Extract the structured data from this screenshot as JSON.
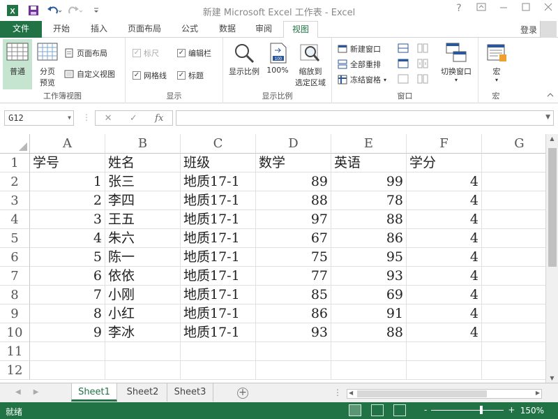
{
  "window": {
    "title": "新建 Microsoft Excel 工作表 - Excel",
    "help": "?"
  },
  "tabs": [
    {
      "label": "文件"
    },
    {
      "label": "开始"
    },
    {
      "label": "插入"
    },
    {
      "label": "页面布局"
    },
    {
      "label": "公式"
    },
    {
      "label": "数据"
    },
    {
      "label": "审阅"
    },
    {
      "label": "视图"
    }
  ],
  "login": "登录",
  "ribbon": {
    "workbook_views": {
      "label": "工作簿视图",
      "normal": "普通",
      "pagebreak_line1": "分页",
      "pagebreak_line2": "预览",
      "page_layout": "页面布局",
      "custom_views": "自定义视图"
    },
    "show": {
      "label": "显示",
      "ruler": "标尺",
      "formula_bar": "编辑栏",
      "gridlines": "网格线",
      "headings": "标题"
    },
    "zoom": {
      "label": "显示比例",
      "zoom": "显示比例",
      "zoom100": "100%",
      "zoom_sel_line1": "缩放到",
      "zoom_sel_line2": "选定区域"
    },
    "window": {
      "label": "窗口",
      "new_window": "新建窗口",
      "arrange_all": "全部重排",
      "freeze_panes": "冻结窗格",
      "switch_windows": "切换窗口"
    },
    "macros": {
      "label": "宏",
      "macros": "宏"
    }
  },
  "formula_bar": {
    "name_box": "G12",
    "fx": "fx",
    "value": ""
  },
  "columns": [
    "A",
    "B",
    "C",
    "D",
    "E",
    "F",
    "G"
  ],
  "rows": [
    {
      "n": "1",
      "a": "学号",
      "b": "姓名",
      "c": "班级",
      "d": "数学",
      "e": "英语",
      "f": "学分"
    },
    {
      "n": "2",
      "a": "1",
      "b": "张三",
      "c": "地质17-1",
      "d": "89",
      "e": "99",
      "f": "4"
    },
    {
      "n": "3",
      "a": "2",
      "b": "李四",
      "c": "地质17-1",
      "d": "88",
      "e": "78",
      "f": "4"
    },
    {
      "n": "4",
      "a": "3",
      "b": "王五",
      "c": "地质17-1",
      "d": "97",
      "e": "88",
      "f": "4"
    },
    {
      "n": "5",
      "a": "4",
      "b": "朱六",
      "c": "地质17-1",
      "d": "67",
      "e": "86",
      "f": "4"
    },
    {
      "n": "6",
      "a": "5",
      "b": "陈一",
      "c": "地质17-1",
      "d": "75",
      "e": "95",
      "f": "4"
    },
    {
      "n": "7",
      "a": "6",
      "b": "依依",
      "c": "地质17-1",
      "d": "77",
      "e": "93",
      "f": "4"
    },
    {
      "n": "8",
      "a": "7",
      "b": "小刚",
      "c": "地质17-1",
      "d": "85",
      "e": "69",
      "f": "4"
    },
    {
      "n": "9",
      "a": "8",
      "b": "小红",
      "c": "地质17-1",
      "d": "86",
      "e": "91",
      "f": "4"
    },
    {
      "n": "10",
      "a": "9",
      "b": "李冰",
      "c": "地质17-1",
      "d": "93",
      "e": "88",
      "f": "4"
    },
    {
      "n": "11",
      "a": "",
      "b": "",
      "c": "",
      "d": "",
      "e": "",
      "f": ""
    },
    {
      "n": "12",
      "a": "",
      "b": "",
      "c": "",
      "d": "",
      "e": "",
      "f": ""
    }
  ],
  "sheets": [
    {
      "label": "Sheet1"
    },
    {
      "label": "Sheet2"
    },
    {
      "label": "Sheet3"
    }
  ],
  "status": {
    "ready": "就绪",
    "zoom_minus": "-",
    "zoom_plus": "+",
    "zoom_pct": "150%"
  },
  "colors": {
    "accent": "#217346"
  }
}
